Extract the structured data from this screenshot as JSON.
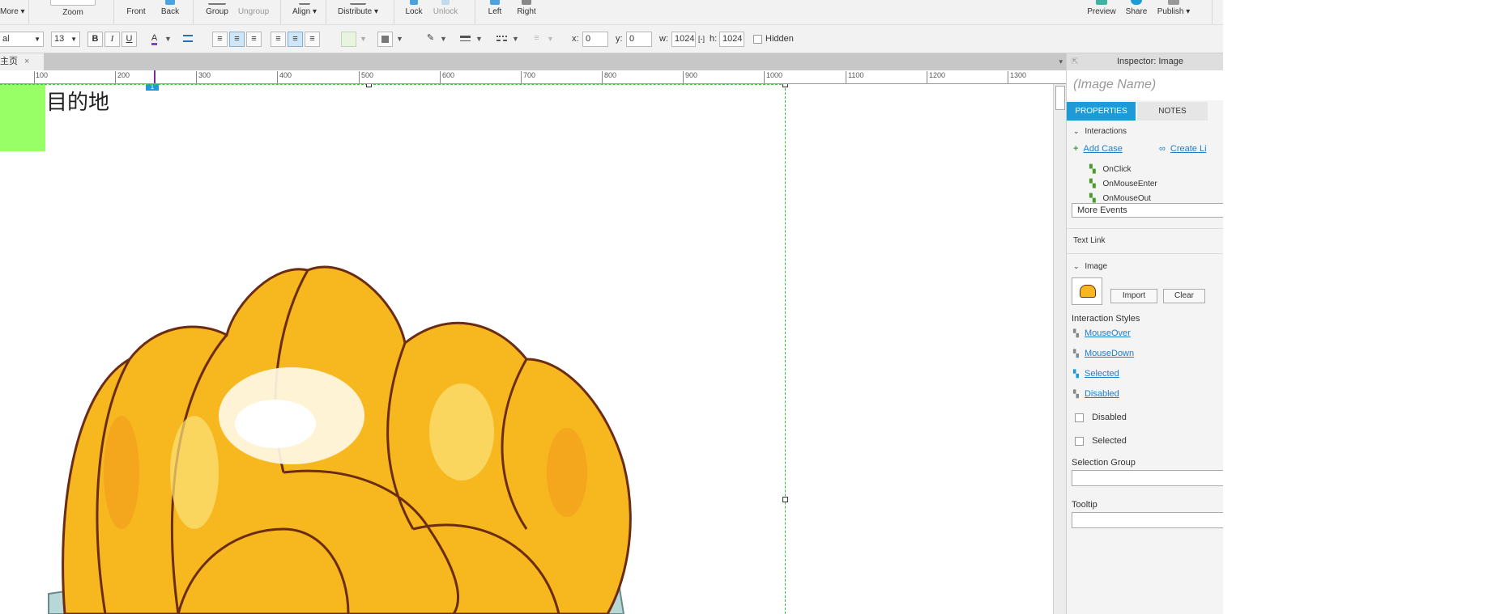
{
  "toolbar": {
    "more_label": "More ▾",
    "zoom_label": "Zoom",
    "front_label": "Front",
    "back_label": "Back",
    "group_label": "Group",
    "ungroup_label": "Ungroup",
    "align_label": "Align ▾",
    "distribute_label": "Distribute ▾",
    "lock_label": "Lock",
    "unlock_label": "Unlock",
    "left_label": "Left",
    "right_label": "Right",
    "preview_label": "Preview",
    "share_label": "Share",
    "publish_label": "Publish ▾"
  },
  "format": {
    "font_family": "al",
    "font_size": "13",
    "bold": "B",
    "italic": "I",
    "underline": "U",
    "font_color_glyph": "A",
    "x_label": "x:",
    "x_value": "0",
    "y_label": "y:",
    "y_value": "0",
    "w_label": "w:",
    "w_value": "1024",
    "h_label": "h:",
    "h_value": "1024",
    "hidden_label": "Hidden"
  },
  "tabs": {
    "page_tab_label": "主页",
    "close_glyph": "×",
    "menu_glyph": "▾"
  },
  "ruler": {
    "ticks": [
      "100",
      "200",
      "300",
      "400",
      "500",
      "600",
      "700",
      "800",
      "900",
      "1000",
      "1100",
      "1200",
      "1300"
    ]
  },
  "canvas": {
    "heading_text": "目的地",
    "marker_glyph": "1"
  },
  "inspector": {
    "title": "Inspector: Image",
    "image_name_placeholder": "(Image Name)",
    "tab_properties": "PROPERTIES",
    "tab_notes": "NOTES",
    "interactions_heading": "Interactions",
    "add_case": "Add Case",
    "create_link": "Create Li",
    "events": [
      "OnClick",
      "OnMouseEnter",
      "OnMouseOut"
    ],
    "more_events": "More Events",
    "text_link": "Text Link",
    "image_heading": "Image",
    "import_label": "Import",
    "clear_label": "Clear",
    "interaction_styles": "Interaction Styles",
    "styles": [
      "MouseOver",
      "MouseDown",
      "Selected",
      "Disabled"
    ],
    "disabled_label": "Disabled",
    "selected_label": "Selected",
    "selection_group": "Selection Group",
    "tooltip": "Tooltip"
  },
  "colors": {
    "accent": "#1e9bd7",
    "green_block": "#99ff66",
    "guide": "#33cc33",
    "link": "#1f7fc7"
  }
}
